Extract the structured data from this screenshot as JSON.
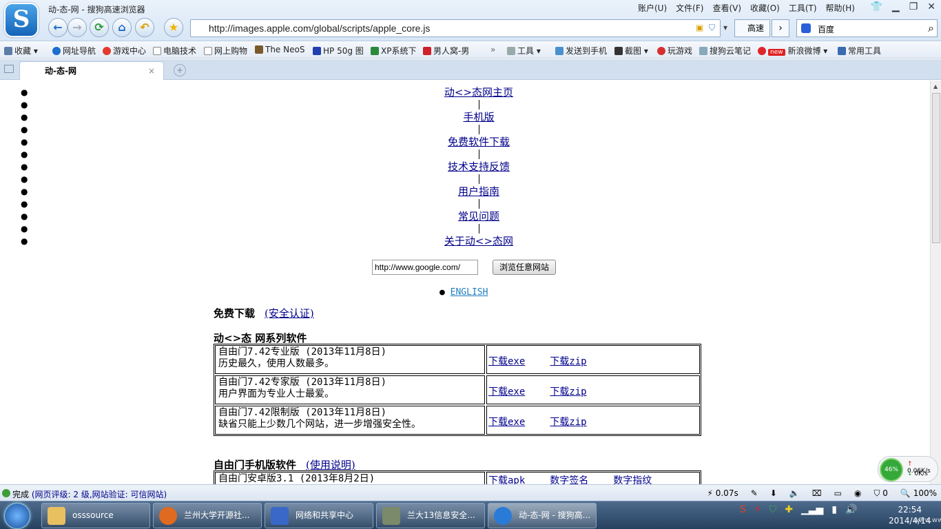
{
  "window": {
    "title": "动-态-网 - 搜狗高速浏览器",
    "menu": [
      "账户(U)",
      "文件(F)",
      "查看(V)",
      "收藏(O)",
      "工具(T)",
      "帮助(H)"
    ]
  },
  "address": {
    "url": "http://images.apple.com/global/scripts/apple_core.js",
    "speed_label": "高速",
    "search_label": "百度"
  },
  "bookmarks": [
    "收藏",
    "网址导航",
    "游戏中心",
    "电脑技术",
    "网上购物",
    "The NeoS",
    "HP 50g 图",
    "XP系统下",
    "男人窝-男",
    "工具",
    "发送到手机",
    "截图",
    "玩游戏",
    "搜狗云笔记",
    "新浪微博",
    "常用工具"
  ],
  "bookmark_badge": "new",
  "tab": {
    "label": "动-态-网"
  },
  "page": {
    "nav_links": [
      "动<>态网主页",
      "手机版",
      "免费软件下载",
      "技术支持反馈",
      "用户指南",
      "常见问题",
      "关于动<>态网"
    ],
    "url_input_value": "http://www.google.com/",
    "browse_button": "浏览任意网站",
    "english_link": "ENGLISH",
    "free_download": "免费下载",
    "security_link": "(安全认证)",
    "series_title": "动<>态 网系列软件",
    "products": [
      {
        "name": "自由门7.42专业版 (2013年11月8日)",
        "desc": "历史最久，使用人数最多。",
        "exe": "下载exe",
        "zip": "下载zip"
      },
      {
        "name": "自由门7.42专家版 (2013年11月8日)",
        "desc": "用户界面为专业人士最爱。",
        "exe": "下载exe",
        "zip": "下载zip"
      },
      {
        "name": "自由门7.42限制版 (2013年11月8日)",
        "desc": "缺省只能上少数几个网站，进一步增强安全性。",
        "exe": "下载exe",
        "zip": "下载zip"
      }
    ],
    "mobile_title": "自由门手机版软件",
    "mobile_help": "(使用说明)",
    "mobile_row": {
      "name": "自由门安卓版3.1 (2013年8月2日)",
      "apk": "下载apk",
      "sig": "数字签名",
      "fp": "数字指纹"
    }
  },
  "speed_widget": {
    "percent": "46%",
    "up": "0.06K/s",
    "down": "0K/s"
  },
  "status": {
    "done": "完成",
    "rating": "(网页评级: 2 级,网站验证: 可信网站)",
    "time": "0.07s",
    "count": "0",
    "zoom": "100%"
  },
  "taskbar": {
    "items": [
      "osssource",
      "兰州大学开源社...",
      "网络和共享中心",
      "兰大13信息安全...",
      "动-态-网 - 搜狗高..."
    ],
    "time": "22:54",
    "date": "2014/4/14",
    "watermark": "www.ww"
  }
}
